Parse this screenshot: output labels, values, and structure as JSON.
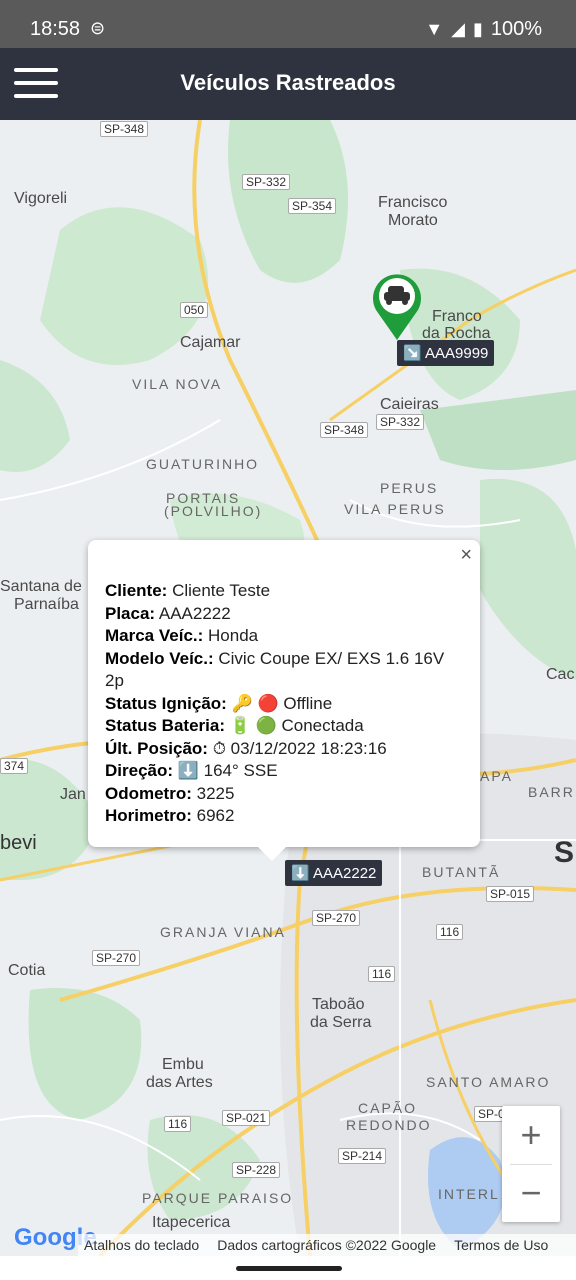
{
  "status_bar": {
    "time": "18:58",
    "battery": "100%"
  },
  "app_bar": {
    "title": "Veículos Rastreados"
  },
  "map": {
    "places": [
      {
        "name": "Vigoreli"
      },
      {
        "name": "Francisco"
      },
      {
        "name": "Morato"
      },
      {
        "name": "Franco"
      },
      {
        "name": "da Rocha"
      },
      {
        "name": "Cajamar"
      },
      {
        "name": "VILA NOVA"
      },
      {
        "name": "Caieiras"
      },
      {
        "name": "GUATURINHO"
      },
      {
        "name": "PORTAIS"
      },
      {
        "name": "(POLVILHO)"
      },
      {
        "name": "PERUS"
      },
      {
        "name": "VILA PERUS"
      },
      {
        "name": "Santana de"
      },
      {
        "name": "Parnaíba"
      },
      {
        "name": "Cac"
      },
      {
        "name": "Jan"
      },
      {
        "name": "APA"
      },
      {
        "name": "BARR"
      },
      {
        "name": "bevi"
      },
      {
        "name": "S"
      },
      {
        "name": "BUTANTÃ"
      },
      {
        "name": "GRANJA VIANA"
      },
      {
        "name": "Cotia"
      },
      {
        "name": "Taboão"
      },
      {
        "name": "da Serra"
      },
      {
        "name": "Embu"
      },
      {
        "name": "das Artes"
      },
      {
        "name": "SANTO AMARO"
      },
      {
        "name": "CAPÃO"
      },
      {
        "name": "REDONDO"
      },
      {
        "name": "PARQUE PARAISO"
      },
      {
        "name": "Itapecerica"
      },
      {
        "name": "INTERL"
      }
    ],
    "shields": [
      "SP-348",
      "SP-332",
      "SP-354",
      "050",
      "SP-348",
      "SP-332",
      "374",
      "SP-015",
      "SP-270",
      "116",
      "SP-270",
      "116",
      "SP-021",
      "116",
      "SP-214",
      "SP-228",
      "SP-0"
    ],
    "markers": [
      {
        "label": "↘️ AAA9999"
      },
      {
        "label": "⬇️ AAA2222"
      }
    ],
    "info_window": {
      "close": "×",
      "rows": [
        {
          "key": "Cliente:",
          "value": " Cliente Teste"
        },
        {
          "key": "Placa:",
          "value": " AAA2222"
        },
        {
          "key": "Marca Veíc.:",
          "value": " Honda"
        },
        {
          "key": "Modelo Veíc.:",
          "value": " Civic Coupe EX/ EXS 1.6 16V 2p"
        },
        {
          "key": "Status Ignição:",
          "value": " 🔑 🔴 Offline"
        },
        {
          "key": "Status Bateria:",
          "value": " 🔋 🟢 Conectada"
        },
        {
          "key": "Últ. Posição:",
          "value": " ⏱ 03/12/2022 18:23:16"
        },
        {
          "key": "Direção:",
          "value": " ⬇️ 164° SSE"
        },
        {
          "key": "Odometro:",
          "value": " 3225"
        },
        {
          "key": "Horimetro:",
          "value": " 6962"
        }
      ]
    },
    "zoom_in": "+",
    "zoom_out": "−",
    "google_logo": "Google",
    "attribution": {
      "shortcuts": "Atalhos do teclado",
      "data": "Dados cartográficos ©2022 Google",
      "terms": "Termos de Uso"
    }
  }
}
